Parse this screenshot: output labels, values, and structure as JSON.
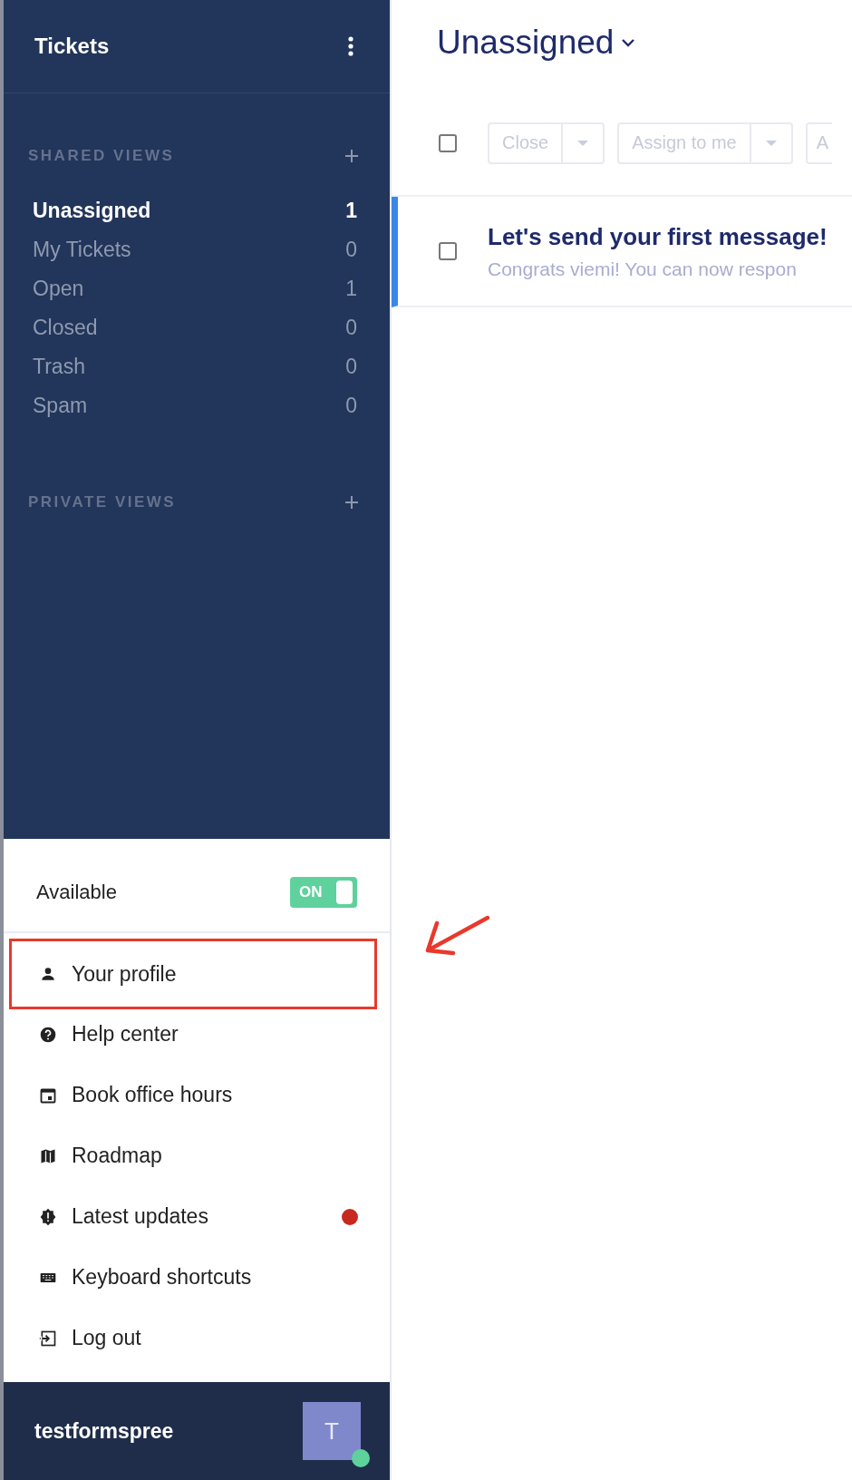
{
  "sidebar": {
    "title": "Tickets",
    "sections": [
      {
        "heading": "SHARED VIEWS",
        "items": [
          {
            "label": "Unassigned",
            "count": "1",
            "selected": true
          },
          {
            "label": "My Tickets",
            "count": "0",
            "selected": false
          },
          {
            "label": "Open",
            "count": "1",
            "selected": false
          },
          {
            "label": "Closed",
            "count": "0",
            "selected": false
          },
          {
            "label": "Trash",
            "count": "0",
            "selected": false
          },
          {
            "label": "Spam",
            "count": "0",
            "selected": false
          }
        ]
      },
      {
        "heading": "PRIVATE VIEWS"
      }
    ]
  },
  "status_menu": {
    "availability": {
      "label": "Available",
      "on": true,
      "toggle_text": "ON"
    },
    "items": [
      {
        "kind": "person",
        "label": "Your profile",
        "highlighted": true,
        "unread": false
      },
      {
        "kind": "help",
        "label": "Help center",
        "highlighted": false,
        "unread": false
      },
      {
        "kind": "calendar",
        "label": "Book office hours",
        "highlighted": false,
        "unread": false
      },
      {
        "kind": "map",
        "label": "Roadmap",
        "highlighted": false,
        "unread": false
      },
      {
        "kind": "badge",
        "label": "Latest updates",
        "highlighted": false,
        "unread": true
      },
      {
        "kind": "keyboard",
        "label": "Keyboard shortcuts",
        "highlighted": false,
        "unread": false
      },
      {
        "kind": "logout",
        "label": "Log out",
        "highlighted": false,
        "unread": false
      }
    ]
  },
  "account": {
    "username": "testformspree",
    "avatar_initial": "T",
    "online": true
  },
  "main": {
    "title": "Unassigned",
    "toolbar": {
      "select_all_checked": false,
      "buttons": [
        {
          "label": "Close",
          "split": true
        },
        {
          "label": "Assign to me",
          "split": true
        },
        {
          "label": "A",
          "split": false
        }
      ]
    },
    "tickets": [
      {
        "title": "Let's send your first message!",
        "preview": "Congrats viemi! You can now respon",
        "checked": false,
        "selected": true
      }
    ]
  }
}
